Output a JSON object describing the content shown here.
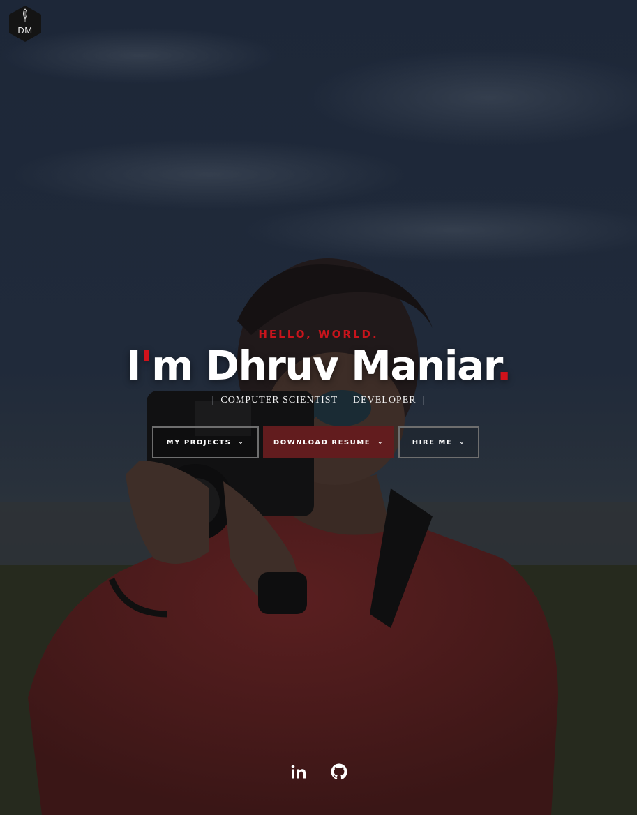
{
  "logo": {
    "text": "DM"
  },
  "hero": {
    "greeting": "HELLO, WORLD.",
    "name_prefix": "I",
    "name_apostrophe": "'",
    "name_main": "m Dhruv Maniar",
    "name_period": ".",
    "roles": [
      "COMPUTER SCIENTIST",
      "DEVELOPER"
    ],
    "separator": "|"
  },
  "buttons": [
    {
      "label": "MY PROJECTS",
      "icon": "chevron-down-icon"
    },
    {
      "label": "DOWNLOAD RESUME",
      "icon": "chevron-down-icon"
    },
    {
      "label": "HIRE ME",
      "icon": "chevron-down-icon"
    }
  ],
  "social": [
    {
      "icon": "linkedin-icon"
    },
    {
      "icon": "github-icon"
    }
  ],
  "colors": {
    "accent": "#d0121b",
    "button_fill": "#621c1e",
    "button_border": "#6e6e6e",
    "text": "#ffffff"
  }
}
